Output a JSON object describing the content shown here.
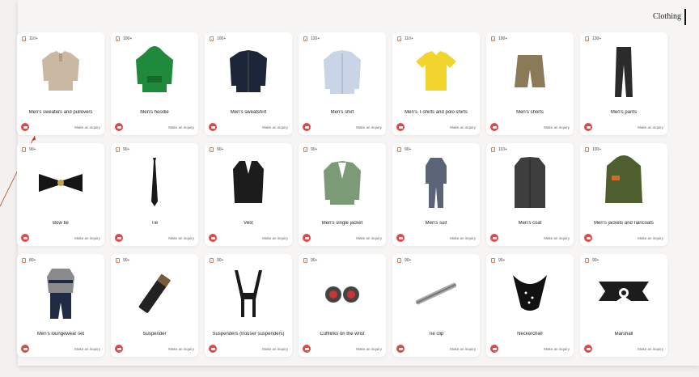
{
  "header": {
    "title": "Clothing"
  },
  "products": [
    {
      "count": "110+",
      "name": "Men's sweaters and pullovers",
      "icon": "sweater",
      "color": "#cbb8a2"
    },
    {
      "count": "100+",
      "name": "Men's hoodie",
      "icon": "hoodie",
      "color": "#1f8a3b"
    },
    {
      "count": "100+",
      "name": "Men's sweatshirt",
      "icon": "jacket",
      "color": "#1d2638"
    },
    {
      "count": "120+",
      "name": "Men's shirt",
      "icon": "shirt",
      "color": "#c9d4e6"
    },
    {
      "count": "110+",
      "name": "Men's T-shirts and polo shirts",
      "icon": "tshirt",
      "color": "#f1d52c"
    },
    {
      "count": "100+",
      "name": "Men's shorts",
      "icon": "shorts",
      "color": "#8a7a58"
    },
    {
      "count": "130+",
      "name": "Men's pants",
      "icon": "pants",
      "color": "#2b2b2b"
    },
    {
      "count": "90+",
      "name": "Bow tie",
      "icon": "bowtie",
      "color": "#151515"
    },
    {
      "count": "90+",
      "name": "Tie",
      "icon": "tie",
      "color": "#1a1a1a"
    },
    {
      "count": "90+",
      "name": "Vest",
      "icon": "vest",
      "color": "#1c1c1c"
    },
    {
      "count": "90+",
      "name": "Men's single jacket",
      "icon": "blazer",
      "color": "#7b9a76"
    },
    {
      "count": "90+",
      "name": "Men's suit",
      "icon": "suit",
      "color": "#5a6378"
    },
    {
      "count": "110+",
      "name": "Men's coat",
      "icon": "coat",
      "color": "#3e3e3e"
    },
    {
      "count": "100+",
      "name": "Men's jackets and raincoats",
      "icon": "parka",
      "color": "#4e5e2f"
    },
    {
      "count": "80+",
      "name": "Men's loungewear set",
      "icon": "lounge",
      "color": "#1f2a44"
    },
    {
      "count": "90+",
      "name": "Suspender",
      "icon": "suspender",
      "color": "#222"
    },
    {
      "count": "90+",
      "name": "Suspenders (trouser suspenders)",
      "icon": "suspenders",
      "color": "#1a1a1a"
    },
    {
      "count": "90+",
      "name": "Cufflinks on the wrist",
      "icon": "cufflinks",
      "color": "#444"
    },
    {
      "count": "90+",
      "name": "Tie clip",
      "icon": "tieclip",
      "color": "#aaa"
    },
    {
      "count": "90+",
      "name": "Neckerchief",
      "icon": "neckerchief",
      "color": "#111"
    },
    {
      "count": "90+",
      "name": "Marshall",
      "icon": "marshall",
      "color": "#1c1c1c"
    }
  ],
  "inquiry_label": "Make an inquiry",
  "accent_color": "#e04848",
  "count_icon_color": "#e8803a"
}
